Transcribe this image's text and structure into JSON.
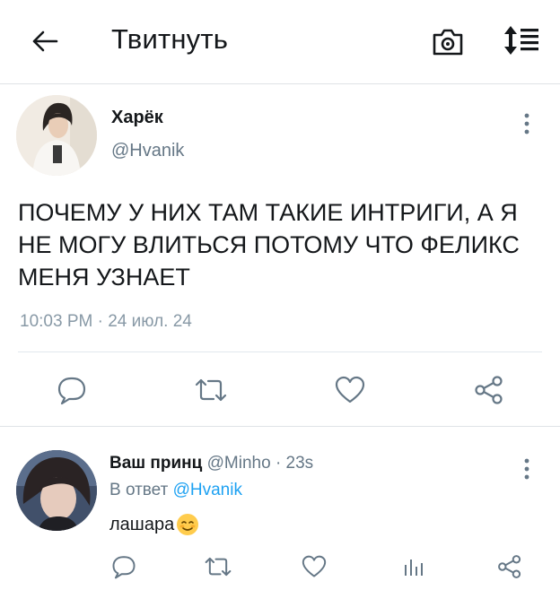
{
  "header": {
    "title": "Твитнуть",
    "back_icon": "arrow-left-icon",
    "camera_icon": "camera-icon",
    "sort_icon": "sort-arrows-icon"
  },
  "tweet": {
    "author_name": "Харёк",
    "author_handle": "@Hvanik",
    "text": "ПОЧЕМУ У НИХ ТАМ ТАКИЕ ИНТРИГИ, А Я НЕ МОГУ ВЛИТЬСЯ ПОТОМУ ЧТО ФЕЛИКС МЕНЯ УЗНАЕТ",
    "meta": "10:03 PM · 24 июл. 24",
    "actions": [
      "reply-icon",
      "retweet-icon",
      "like-icon",
      "share-icon"
    ]
  },
  "reply": {
    "author_name": "Ваш принц",
    "author_handle": "@Minho",
    "dot": " · ",
    "time": "23s",
    "reply_prefix": "В ответ",
    "reply_to": "@Hvanik",
    "text": "лашара",
    "emoji": "smiling-face-emoji",
    "actions": [
      "reply-icon",
      "retweet-icon",
      "like-icon",
      "stats-icon",
      "share-icon"
    ]
  },
  "colors": {
    "text": "#14171a",
    "secondary": "#657786",
    "link": "#1da1f2",
    "icon": "#657786",
    "divider": "#e1e8ed"
  }
}
